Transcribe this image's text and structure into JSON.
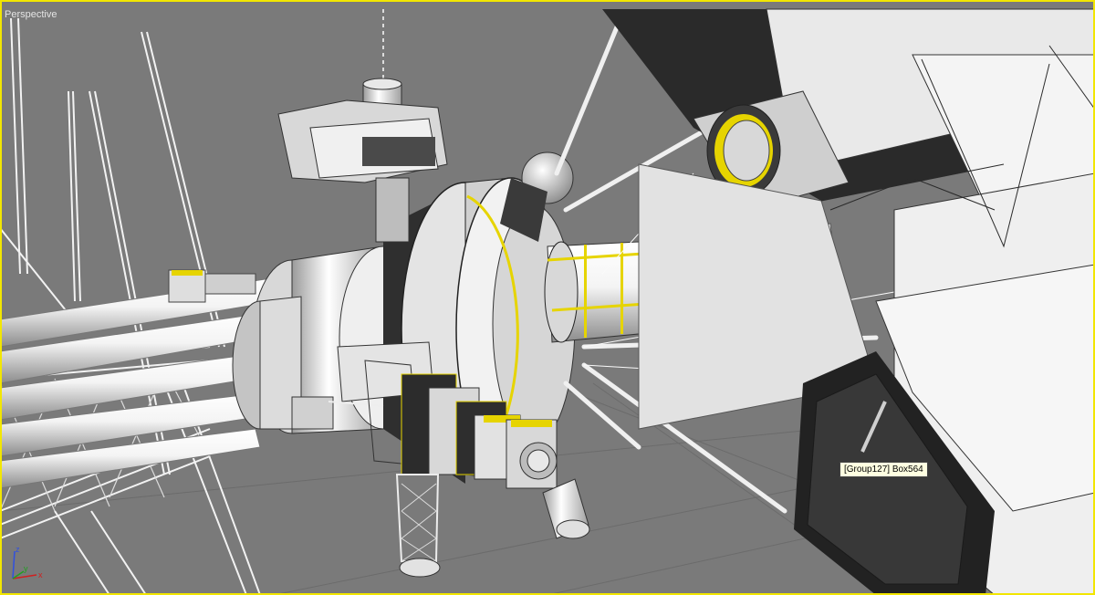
{
  "viewport": {
    "label": "Perspective",
    "frame_color": "#f2e600",
    "background_color": "#7a7a7a"
  },
  "tooltip": {
    "text": "[Group127] Box564"
  },
  "axis_tripod": {
    "x_label": "x",
    "y_label": "y",
    "z_label": "z",
    "x_color": "#d02020",
    "y_color": "#20a020",
    "z_color": "#3050e0"
  }
}
